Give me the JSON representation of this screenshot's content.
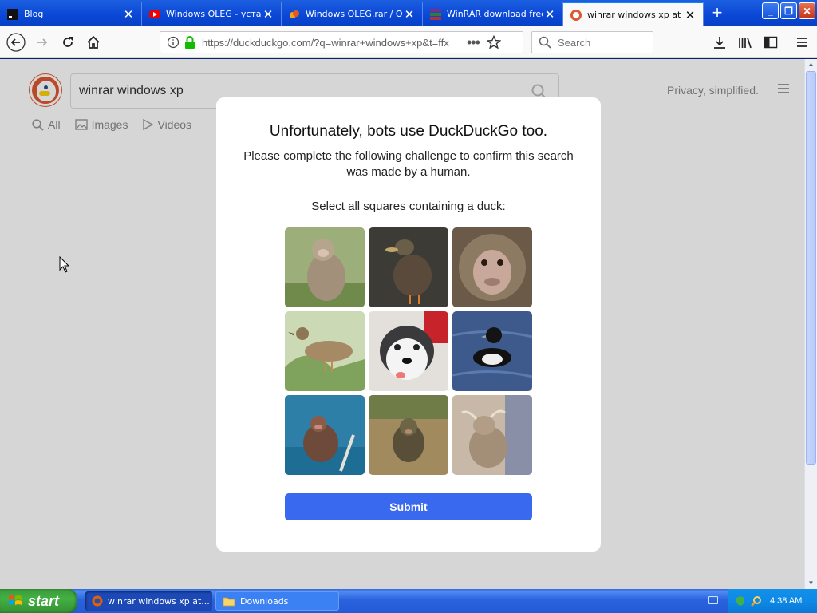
{
  "browser": {
    "tabs": [
      {
        "label": "Blog",
        "favicon": "terminal-icon",
        "active": false
      },
      {
        "label": "Windows OLEG - устанс",
        "favicon": "youtube-icon",
        "active": false
      },
      {
        "label": "Windows OLEG.rar / Об",
        "favicon": "cloud-icon",
        "active": false
      },
      {
        "label": "WinRAR download free",
        "favicon": "winrar-icon",
        "active": false
      },
      {
        "label": "winrar windows xp at Du",
        "favicon": "duckduckgo-icon",
        "active": true
      }
    ],
    "url": "https://duckduckgo.com/?q=winrar+windows+xp&t=ffx",
    "search_placeholder": "Search"
  },
  "page": {
    "search_query": "winrar windows xp",
    "tabs": {
      "all": "All",
      "images": "Images",
      "videos": "Videos"
    },
    "privacy": "Privacy, simplified."
  },
  "challenge": {
    "title": "Unfortunately, bots use DuckDuckGo too.",
    "subtitle": "Please complete the following challenge to confirm this search was made by a human.",
    "instruction": "Select all squares containing a duck:",
    "submit_label": "Submit",
    "tiles": [
      "monkey",
      "duck",
      "monkey",
      "duck",
      "dog",
      "duck",
      "monkey",
      "monkey",
      "goat"
    ]
  },
  "taskbar": {
    "start_label": "start",
    "items": [
      {
        "label": "winrar windows xp at...",
        "icon": "firefox-icon"
      },
      {
        "label": "Downloads",
        "icon": "folder-icon"
      }
    ],
    "clock": "4:38 AM"
  },
  "colors": {
    "xp_blue": "#0a47d6",
    "submit_blue": "#3969ef",
    "ddg_orange": "#de5833"
  }
}
